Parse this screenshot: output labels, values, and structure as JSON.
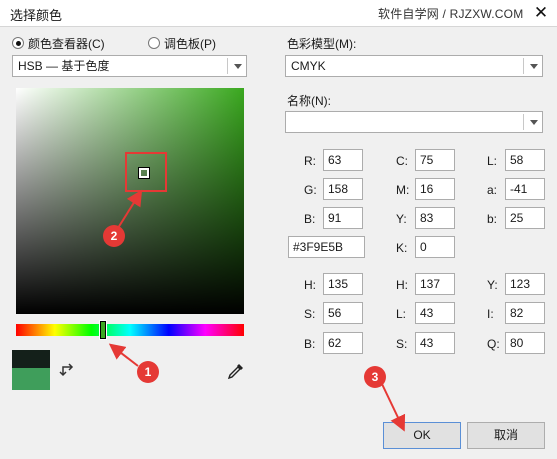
{
  "window": {
    "title": "选择颜色",
    "watermark": "软件自学网 / RJZXW.COM",
    "close_glyph": "✕"
  },
  "viewer_mode": {
    "option_viewers": {
      "label": "颜色查看器(C)",
      "selected": true
    },
    "option_palettes": {
      "label": "调色板(P)",
      "selected": false
    }
  },
  "viewer_model_combo": {
    "value": "HSB — 基于色度"
  },
  "color_model": {
    "label": "色彩模型(M):",
    "value": "CMYK"
  },
  "name": {
    "label": "名称(N):",
    "value": ""
  },
  "colors": {
    "old": "#14201A",
    "new": "#3F9E5B",
    "hue_base": "#3AA81F",
    "highlight": "#E53935"
  },
  "hue_slider_level": 0.38,
  "values": {
    "rgb": {
      "r_label": "R:",
      "r": "63",
      "g_label": "G:",
      "g": "158",
      "b_label": "B:",
      "b": "91"
    },
    "hex": "#3F9E5B",
    "cmyk": {
      "c_label": "C:",
      "c": "75",
      "m_label": "M:",
      "m": "16",
      "y_label": "Y:",
      "y": "83",
      "k_label": "K:",
      "k": "0"
    },
    "lab": {
      "l_label": "L:",
      "l": "58",
      "a_label": "a:",
      "a": "-41",
      "b_label": "b:",
      "b": "25"
    },
    "hsb": {
      "h_label": "H:",
      "h": "135",
      "s_label": "S:",
      "s": "56",
      "b_label": "B:",
      "b": "62"
    },
    "hls": {
      "h_label": "H:",
      "h": "137",
      "l_label": "L:",
      "l": "43",
      "s_label": "S:",
      "s": "43"
    },
    "yiq": {
      "y_label": "Y:",
      "y": "123",
      "i_label": "I:",
      "i": "82",
      "q_label": "Q:",
      "q": "80"
    }
  },
  "buttons": {
    "ok": "OK",
    "cancel": "取消"
  },
  "annotations": {
    "one": "1",
    "two": "2",
    "three": "3"
  },
  "icons": {
    "swap": "swap-colors-icon",
    "eyedropper": "eyedropper-icon"
  }
}
